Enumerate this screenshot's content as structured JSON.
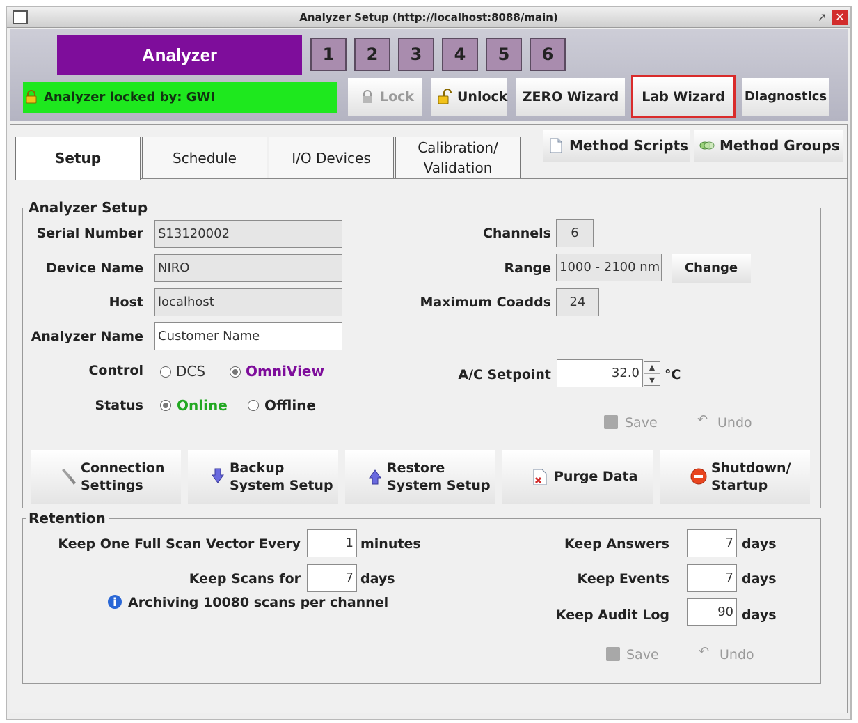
{
  "window": {
    "title": "Analyzer Setup (http://localhost:8088/main)"
  },
  "header": {
    "brand": "Analyzer",
    "channels": [
      "1",
      "2",
      "3",
      "4",
      "5",
      "6"
    ],
    "lock_status": "Analyzer locked by: GWI",
    "buttons": {
      "lock": "Lock",
      "unlock": "Unlock",
      "zero_wizard": "ZERO Wizard",
      "lab_wizard": "Lab Wizard",
      "diagnostics": "Diagnostics"
    },
    "highlight_color": "#d92b2b",
    "brand_color": "#7e0d9b",
    "lock_bar_color": "#1ee81e"
  },
  "tabs": [
    {
      "label": "Setup",
      "active": true
    },
    {
      "label": "Schedule"
    },
    {
      "label": "I/O Devices"
    },
    {
      "label_line1": "Calibration/",
      "label_line2": "Validation"
    }
  ],
  "side_buttons": {
    "method_scripts": "Method Scripts",
    "method_groups": "Method Groups"
  },
  "analyzer_setup": {
    "legend": "Analyzer Setup",
    "serial_number": {
      "label": "Serial Number",
      "value": "S13120002"
    },
    "device_name": {
      "label": "Device Name",
      "value": "NIRO"
    },
    "host": {
      "label": "Host",
      "value": "localhost"
    },
    "analyzer_name": {
      "label": "Analyzer Name",
      "value": "Customer Name"
    },
    "control": {
      "label": "Control",
      "options": [
        "DCS",
        "OmniView"
      ],
      "selected": "OmniView"
    },
    "status": {
      "label": "Status",
      "options": [
        "Online",
        "Offline"
      ],
      "selected": "Online"
    },
    "channels": {
      "label": "Channels",
      "value": "6"
    },
    "range": {
      "label": "Range",
      "value": "1000 - 2100 nm",
      "change": "Change"
    },
    "max_coadds": {
      "label": "Maximum Coadds",
      "value": "24"
    },
    "ac_setpoint": {
      "label": "A/C Setpoint",
      "value": "32.0",
      "unit": "°C"
    },
    "save": "Save",
    "undo": "Undo"
  },
  "action_buttons": {
    "connection": {
      "line1": "Connection",
      "line2": "Settings"
    },
    "backup": {
      "line1": "Backup",
      "line2": "System Setup"
    },
    "restore": {
      "line1": "Restore",
      "line2": "System Setup"
    },
    "purge": {
      "label": "Purge Data"
    },
    "shutdown": {
      "line1": "Shutdown/",
      "line2": "Startup"
    }
  },
  "retention": {
    "legend": "Retention",
    "full_scan": {
      "label": "Keep One Full Scan Vector Every",
      "value": "1",
      "unit": "minutes"
    },
    "keep_scans": {
      "label": "Keep Scans for",
      "value": "7",
      "unit": "days"
    },
    "archiving": "Archiving 10080 scans per channel",
    "keep_answers": {
      "label": "Keep Answers",
      "value": "7",
      "unit": "days"
    },
    "keep_events": {
      "label": "Keep Events",
      "value": "7",
      "unit": "days"
    },
    "keep_audit": {
      "label": "Keep Audit Log",
      "value": "90",
      "unit": "days"
    },
    "save": "Save",
    "undo": "Undo"
  }
}
